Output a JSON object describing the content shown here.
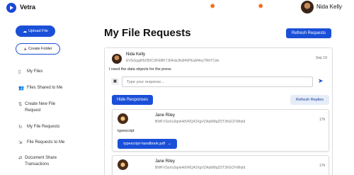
{
  "app": {
    "brand": "Vetra",
    "accent": "#1a4fd8"
  },
  "header": {
    "user_name": "Nida Kelly",
    "theme_icons": [
      "sun-icon",
      "sun-icon"
    ]
  },
  "sidebar": {
    "upload_label": "Upload File",
    "create_folder_label": "Create Folder",
    "items": [
      {
        "label": "My Files",
        "icon": "document-icon"
      },
      {
        "label": "Files Shared to Me",
        "icon": "people-icon"
      },
      {
        "label": "Create New File Request",
        "icon": "request-icon"
      },
      {
        "label": "My File Requests",
        "icon": "refresh-icon"
      },
      {
        "label": "File Requests to Me",
        "icon": "inbox-icon"
      },
      {
        "label": "Document Share Transactions",
        "icon": "transactions-icon"
      }
    ]
  },
  "main": {
    "title": "My File Requests",
    "refresh_requests_label": "Refresh Requests",
    "request": {
      "name": "Nida Kelly",
      "id": "EVGGpgR5ZBXC9FEBKTJ64obJfsi945PEaM4nyTRhTCdo",
      "date": "Sep 19",
      "message": "I need the data objects for the press",
      "reply_placeholder": "Type your response...",
      "hide_responses_label": "Hide Responses",
      "refresh_replies_label": "Refresh Replies"
    },
    "responses": [
      {
        "name": "Jane Riley",
        "id": "BWFVSoXo3qnk4dVRQ42XgVZAqW8qZDT3hGCFWIrjId",
        "time": "17h",
        "text": "typescript",
        "file_label": "typescript-handbook.pdf"
      },
      {
        "name": "Jane Riley",
        "id": "BWFVSoXo3qnk4dVRQ42XgVZAqW8qZDT3hGCFWIrjId",
        "time": "17h"
      }
    ]
  }
}
